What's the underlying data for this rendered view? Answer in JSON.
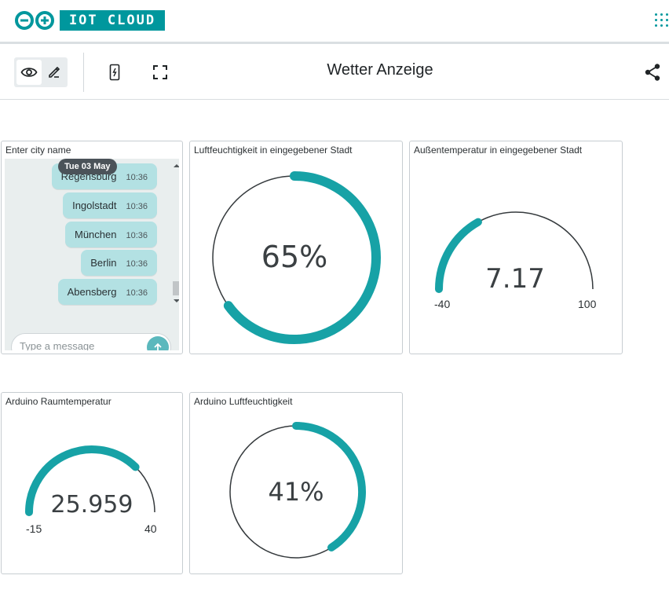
{
  "brand": {
    "text": "IOT CLOUD",
    "color": "#00979d",
    "logo_icon": "arduino-infinity-icon"
  },
  "toolbar": {
    "title": "Wetter Anzeige",
    "view_icon": "eye-icon",
    "edit_icon": "pencil-icon",
    "mobile_icon": "mobile-phone-icon",
    "fullscreen_icon": "fullscreen-icon",
    "share_icon": "share-icon",
    "apps_icon": "apps-grid-icon"
  },
  "chat": {
    "title": "Enter city name",
    "date_label": "Tue 03 May",
    "messages": [
      {
        "text": "Regensburg",
        "time": "10:36"
      },
      {
        "text": "Ingolstadt",
        "time": "10:36"
      },
      {
        "text": "München",
        "time": "10:36"
      },
      {
        "text": "Berlin",
        "time": "10:36"
      },
      {
        "text": "Abensberg",
        "time": "10:36"
      }
    ],
    "placeholder": "Type a message"
  },
  "widgets": {
    "humidity_city": {
      "title": "Luftfeuchtigkeit in eingegebener Stadt",
      "value_label": "65%",
      "value": 65
    },
    "temp_city": {
      "title": "Außentemperatur in eingegebener Stadt",
      "value_label": "7.17",
      "value": 7.17,
      "min_label": "-40",
      "max_label": "100",
      "min": -40,
      "max": 100
    },
    "temp_room": {
      "title": "Arduino Raumtemperatur",
      "value_label": "25.959",
      "value": 25.959,
      "min_label": "-15",
      "max_label": "40",
      "min": -15,
      "max": 40
    },
    "humidity_arduino": {
      "title": "Arduino Luftfeuchtigkeit",
      "value_label": "41%",
      "value": 41
    }
  },
  "colors": {
    "accent": "#00979d",
    "gauge": "#17a2a6",
    "track": "#353a3d"
  }
}
